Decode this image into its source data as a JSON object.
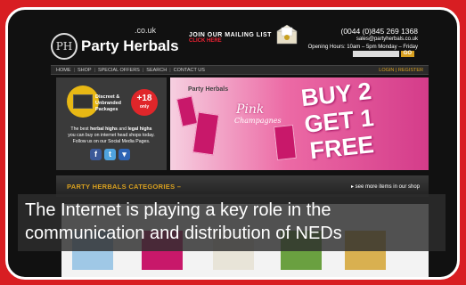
{
  "header": {
    "logo_mark": "PH",
    "logo_name": "Party Herbals",
    "logo_tld": ".co.uk",
    "mailing_title": "JOIN OUR MAILING LIST",
    "mailing_sub": "CLICK HERE",
    "phone": "(0044 (0)845 269 1368",
    "email": "sales@partyherbals.co.uk",
    "hours": "Opening Hours: 10am – 5pm Monday – Friday",
    "search_button": "GO"
  },
  "nav": {
    "items": [
      "HOME",
      "SHOP",
      "SPECIAL OFFERS",
      "SEARCH",
      "CONTACT US"
    ],
    "separator": "|",
    "account": "LOGIN  |  REGISTER"
  },
  "promo": {
    "badge1_label_1": "Discreet &",
    "badge1_label_2": "Unbranded",
    "badge1_label_3": "Packages",
    "badge2_number": "+18",
    "badge2_text": "only",
    "tagline_1a": "The best ",
    "tagline_1b": "herbal highs",
    "tagline_1c": " and ",
    "tagline_1d": "legal highs",
    "tagline_2": "you can buy on internet head shops today.",
    "tagline_3": "Follow us on our Social Media Pages.",
    "social": [
      "f",
      "t",
      "▾"
    ]
  },
  "banner": {
    "brand": "Party Herbals",
    "product_1": "Pink",
    "product_2": "Champagnes",
    "headline_1": "BUY 2",
    "headline_2": "GET 1",
    "headline_3": "FREE"
  },
  "categories": {
    "title": "PARTY HERBALS CATEGORIES –",
    "link": "▸ see more items in our shop"
  },
  "caption": {
    "line_1": "The Internet is playing a key role in the",
    "line_2": "communication and distribution of NEDs"
  },
  "colors": {
    "outer": "#d81e22",
    "accent_gold": "#d8a020",
    "banner_pink": "#e24a96",
    "facebook": "#3b5998",
    "twitter": "#4fa3df",
    "social3": "#2e64b4"
  }
}
